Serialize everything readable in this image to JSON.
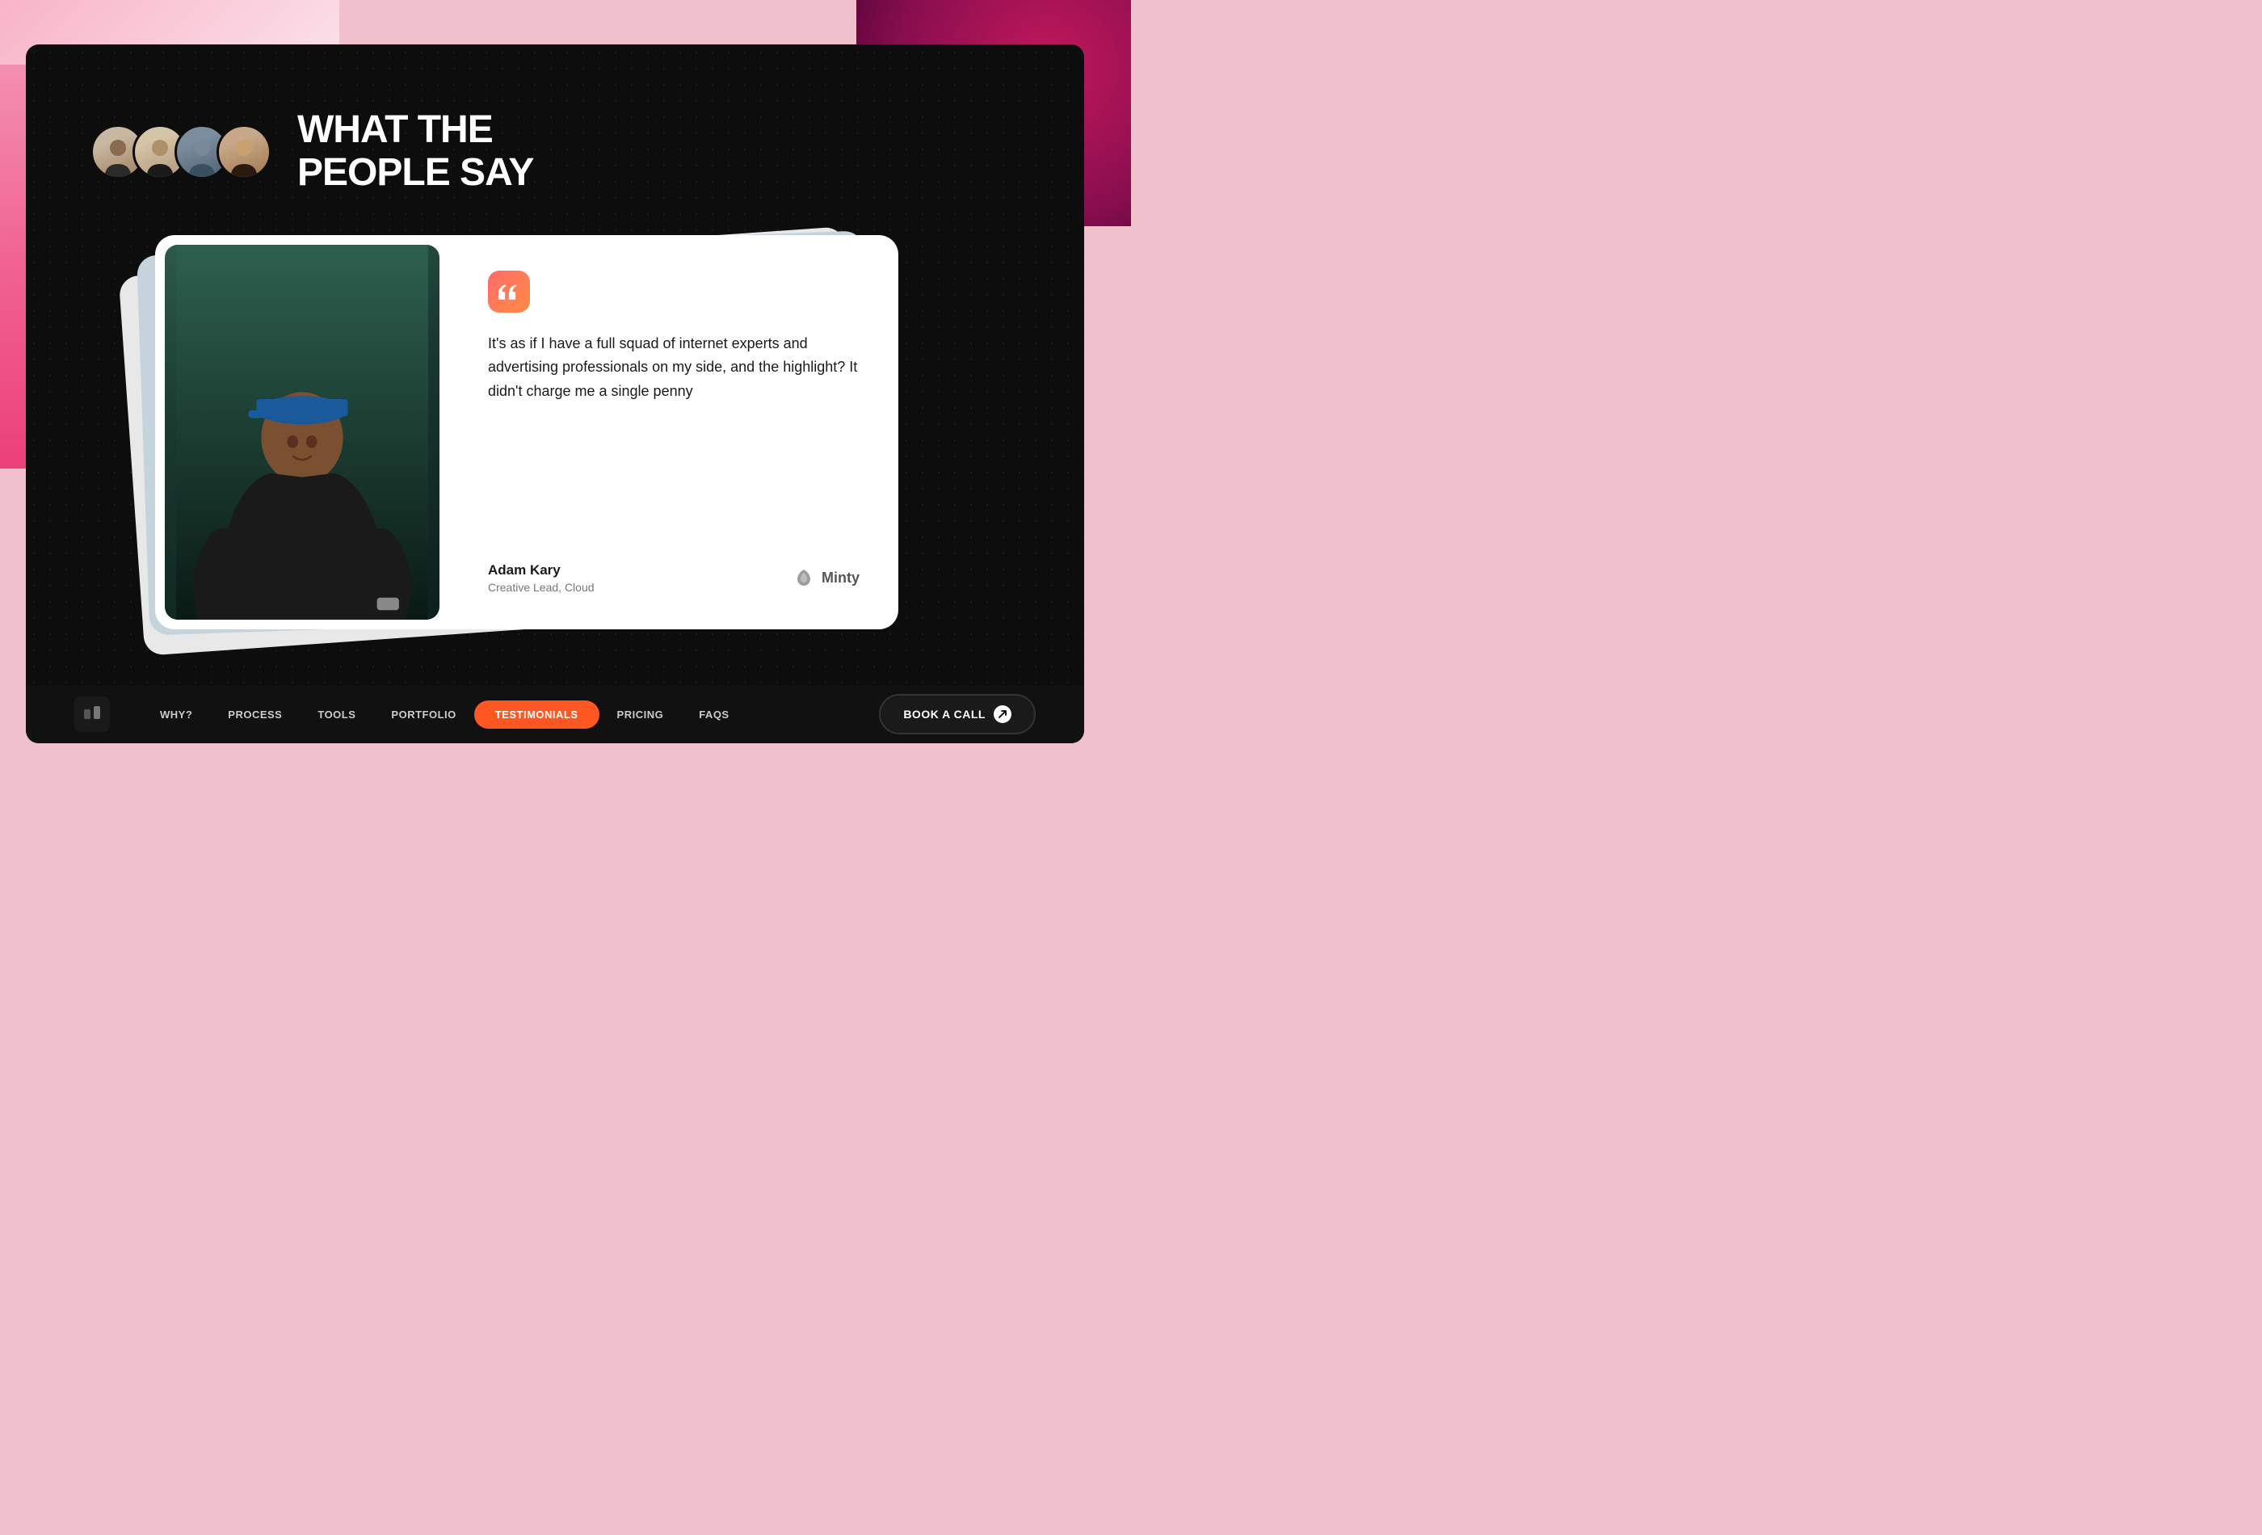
{
  "background": {
    "accent_color": "#f0c0cc",
    "blob_color_left": "#f48fb1",
    "blob_color_right": "#880e4f"
  },
  "section": {
    "title_line1": "WHAT THE",
    "title_line2": "PEOPLE SAY"
  },
  "avatars": [
    {
      "id": 1,
      "alt": "Person 1"
    },
    {
      "id": 2,
      "alt": "Person 2"
    },
    {
      "id": 3,
      "alt": "Person 3"
    },
    {
      "id": 4,
      "alt": "Person 4"
    }
  ],
  "testimonial": {
    "quote": "It's as if I have a full squad of internet experts and advertising professionals on my side, and the highlight? It didn't charge me a single penny",
    "author_name": "Adam Kary",
    "author_role": "Creative Lead, Cloud",
    "company": "Minty",
    "quote_icon": "❝"
  },
  "nav": {
    "items": [
      {
        "label": "WHY?",
        "active": false
      },
      {
        "label": "PROCESS",
        "active": false
      },
      {
        "label": "TOOLS",
        "active": false
      },
      {
        "label": "PORTFOLIO",
        "active": false
      },
      {
        "label": "TESTIMONIALS",
        "active": true
      },
      {
        "label": "Pricing",
        "active": false
      },
      {
        "label": "FAQs",
        "active": false
      }
    ],
    "cta_label": "BOOK A CALL"
  }
}
